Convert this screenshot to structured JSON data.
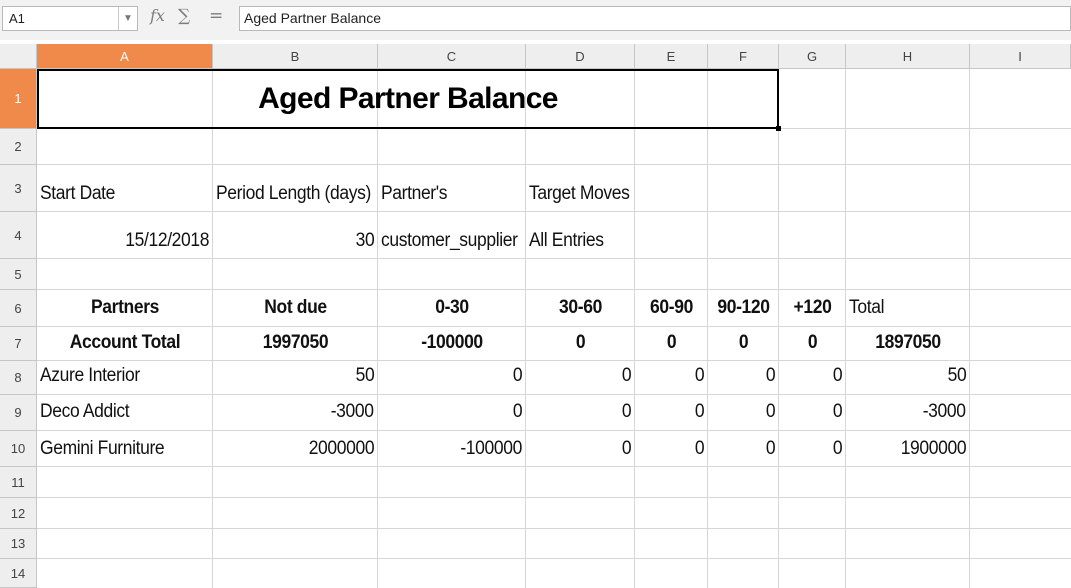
{
  "formula_bar": {
    "name_box": "A1",
    "fx_icon": "fx",
    "sum_icon": "∑",
    "equals_icon": "=",
    "content": "Aged Partner Balance"
  },
  "columns": [
    "A",
    "B",
    "C",
    "D",
    "E",
    "F",
    "G",
    "H",
    "I"
  ],
  "rows": [
    "1",
    "2",
    "3",
    "4",
    "5",
    "6",
    "7",
    "8",
    "9",
    "10",
    "11",
    "12",
    "13",
    "14"
  ],
  "selected_cell": "A1",
  "accent_color": "#f08a4b",
  "sheet": {
    "title": "Aged Partner Balance",
    "info_labels": [
      "Start Date",
      "Period Length (days)",
      "Partner's",
      "Target Moves"
    ],
    "info_values": [
      "15/12/2018",
      "30",
      "customer_supplier",
      "All Entries"
    ],
    "headers": [
      "Partners",
      "Not due",
      "0-30",
      "30-60",
      "60-90",
      "90-120",
      "+120",
      "Total"
    ],
    "account_total": [
      "Account Total",
      "1997050",
      "-100000",
      "0",
      "0",
      "0",
      "0",
      "1897050"
    ],
    "partners": [
      [
        "Azure Interior",
        "50",
        "0",
        "0",
        "0",
        "0",
        "0",
        "50"
      ],
      [
        "Deco Addict",
        "-3000",
        "0",
        "0",
        "0",
        "0",
        "0",
        "-3000"
      ],
      [
        "Gemini Furniture",
        "2000000",
        "-100000",
        "0",
        "0",
        "0",
        "0",
        "1900000"
      ]
    ]
  }
}
